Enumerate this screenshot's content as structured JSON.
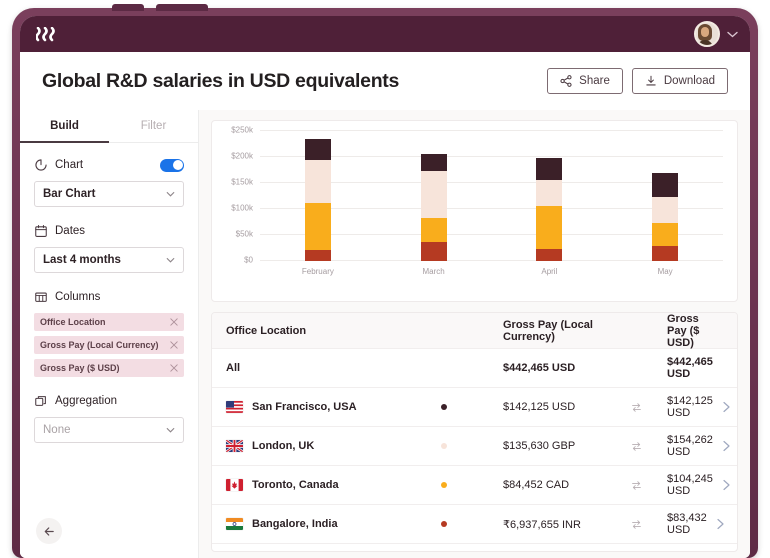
{
  "appbar": {
    "logo_name": "remote-logo",
    "avatar_name": "user-avatar",
    "chevron": "⌄"
  },
  "header": {
    "title": "Global R&D salaries in USD equivalents",
    "share_label": "Share",
    "download_label": "Download"
  },
  "sidebar": {
    "tabs": [
      {
        "label": "Build",
        "active": true
      },
      {
        "label": "Filter",
        "active": false
      }
    ],
    "groups": {
      "chart": {
        "label": "Chart",
        "toggle_on": true,
        "select_value": "Bar Chart"
      },
      "dates": {
        "label": "Dates",
        "select_value": "Last 4 months"
      },
      "columns": {
        "label": "Columns",
        "chips": [
          "Office Location",
          "Gross Pay (Local Currency)",
          "Gross Pay ($ USD)"
        ]
      },
      "aggregation": {
        "label": "Aggregation",
        "placeholder": "None"
      }
    },
    "back_button": "←"
  },
  "chart_data": {
    "type": "bar",
    "stacked": true,
    "title": "",
    "xlabel": "",
    "ylabel": "",
    "ylim": [
      0,
      250000
    ],
    "grid": true,
    "legend": "none",
    "ytick_labels": [
      "$0",
      "$50k",
      "$100k",
      "$150k",
      "$200k",
      "$250k"
    ],
    "ytick_values": [
      0,
      50000,
      100000,
      150000,
      200000,
      250000
    ],
    "categories": [
      "February",
      "March",
      "April",
      "May"
    ],
    "series": [
      {
        "name": "Bangalore, India",
        "color": "#b53a22",
        "values": [
          21000,
          36000,
          23000,
          28000
        ]
      },
      {
        "name": "Toronto, Canada",
        "color": "#f9ad1c",
        "values": [
          90000,
          46000,
          82000,
          46000
        ]
      },
      {
        "name": "London, UK",
        "color": "#f7e4da",
        "values": [
          83000,
          91000,
          50000,
          49000
        ]
      },
      {
        "name": "San Francisco, USA",
        "color": "#3b2028",
        "values": [
          41000,
          32000,
          44000,
          46000
        ]
      }
    ],
    "totals": [
      235000,
      205000,
      199000,
      169000
    ]
  },
  "table": {
    "columns": [
      "Office Location",
      "Gross Pay (Local Currency)",
      "Gross Pay ($ USD)"
    ],
    "swap_icon": "swap-icon",
    "chevron_icon": "chevron-right-icon",
    "total_row": {
      "label": "All",
      "local": "$442,465 USD",
      "usd": "$442,465 USD"
    },
    "rows": [
      {
        "location": "San Francisco, USA",
        "flag": "us-flag",
        "dot_color": "#3b2028",
        "local": "$142,125 USD",
        "usd": "$142,125 USD"
      },
      {
        "location": "London, UK",
        "flag": "uk-flag",
        "dot_color": "#f7e4da",
        "local": "$135,630 GBP",
        "usd": "$154,262 USD"
      },
      {
        "location": "Toronto, Canada",
        "flag": "ca-flag",
        "dot_color": "#f9ad1c",
        "local": "$84,452 CAD",
        "usd": "$104,245 USD"
      },
      {
        "location": "Bangalore, India",
        "flag": "in-flag",
        "dot_color": "#b53a22",
        "local": "₹6,937,655 INR",
        "usd": "$83,432 USD"
      }
    ]
  }
}
